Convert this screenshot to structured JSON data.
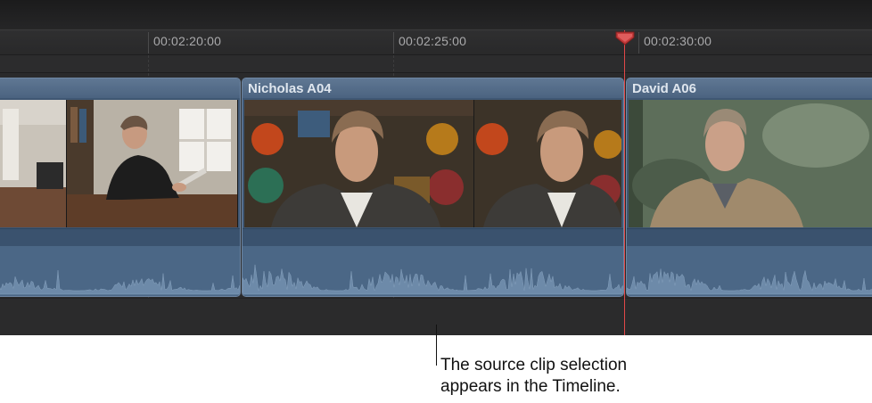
{
  "timeline": {
    "ruler": {
      "timecodes": [
        "00:02:20:00",
        "00:02:25:00",
        "00:02:30:00"
      ]
    },
    "clips": [
      {
        "name": ""
      },
      {
        "name": "Nicholas A04"
      },
      {
        "name": "David A06"
      }
    ],
    "colors": {
      "clip_fill": "#3f5773",
      "clip_header": "#5f7793",
      "waveform": "#6d8aa9",
      "playhead": "#e24848"
    }
  },
  "callout": {
    "line1": "The source clip selection",
    "line2": "appears in the Timeline."
  }
}
